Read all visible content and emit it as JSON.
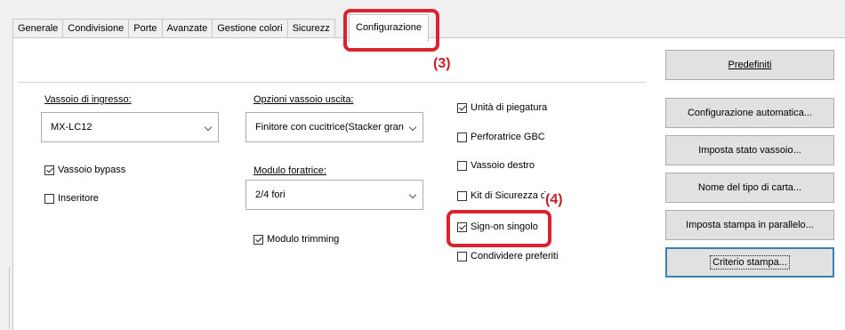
{
  "tabs": [
    {
      "label": "Generale"
    },
    {
      "label": "Condivisione"
    },
    {
      "label": "Porte"
    },
    {
      "label": "Avanzate"
    },
    {
      "label": "Gestione colori"
    },
    {
      "label": "Sicurezz"
    }
  ],
  "active_tab": "Configurazione",
  "callouts": {
    "c3": "(3)",
    "c4": "(4)"
  },
  "column1": {
    "input_tray_label": "Vassoio di ingresso:",
    "input_tray_value": "MX-LC12",
    "bypass_label": "Vassoio bypass",
    "bypass_checked": true,
    "inserter_label": "Inseritore",
    "inserter_checked": false
  },
  "column2": {
    "output_options_label": "Opzioni vassoio uscita:",
    "output_options_value": "Finitore con cucitrice(Stacker gran",
    "punch_module_label": "Modulo foratrice:",
    "punch_module_value": "2/4 fori",
    "trimming_label": "Modulo trimming",
    "trimming_checked": true
  },
  "column3": {
    "items": [
      {
        "label": "Unità di piegatura",
        "checked": true
      },
      {
        "label": "Perforatrice GBC",
        "checked": false
      },
      {
        "label": "Vassoio destro",
        "checked": false
      },
      {
        "label": "Kit di Sicurezza d",
        "checked": false
      },
      {
        "label": "Sign-on singolo",
        "checked": true
      },
      {
        "label": "Condividere preferiti",
        "checked": false
      }
    ]
  },
  "buttons": {
    "defaults": "Predefiniti",
    "auto_config": "Configurazione automatica...",
    "tray_status": "Imposta stato vassoio...",
    "paper_type_name": "Nome del tipo di carta...",
    "parallel_print": "Imposta stampa in parallelo...",
    "print_policy": "Criterio stampa..."
  },
  "colors": {
    "callout": "#d9232e",
    "focus": "#3c7fb1"
  }
}
